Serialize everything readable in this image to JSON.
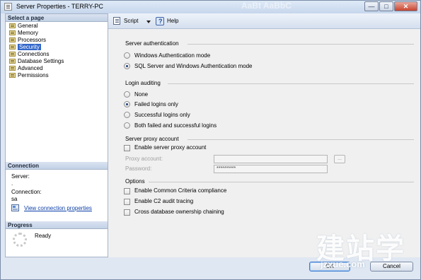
{
  "window": {
    "title": "Server Properties - TERRY-PC",
    "ghost_text": "AaBt AaBbC"
  },
  "titlebar_buttons": {
    "minimize": "—",
    "maximize": "□",
    "close": "✕"
  },
  "left": {
    "select_page_header": "Select a page",
    "pages": [
      {
        "label": "General"
      },
      {
        "label": "Memory"
      },
      {
        "label": "Processors"
      },
      {
        "label": "Security",
        "selected": true
      },
      {
        "label": "Connections"
      },
      {
        "label": "Database Settings"
      },
      {
        "label": "Advanced"
      },
      {
        "label": "Permissions"
      }
    ],
    "connection_header": "Connection",
    "server_label": "Server:",
    "server_value": ".",
    "connection_label": "Connection:",
    "connection_value": "sa",
    "view_link": "View connection properties",
    "progress_header": "Progress",
    "progress_status": "Ready"
  },
  "toolbar": {
    "script_label": "Script",
    "help_label": "Help"
  },
  "server_auth": {
    "title": "Server authentication",
    "options": [
      {
        "label": "Windows Authentication mode",
        "checked": false
      },
      {
        "label": "SQL Server and Windows Authentication mode",
        "checked": true
      }
    ]
  },
  "login_auditing": {
    "title": "Login auditing",
    "options": [
      {
        "label": "None",
        "checked": false
      },
      {
        "label": "Failed logins only",
        "checked": true
      },
      {
        "label": "Successful logins only",
        "checked": false
      },
      {
        "label": "Both failed and successful logins",
        "checked": false
      }
    ]
  },
  "proxy": {
    "title": "Server proxy account",
    "enable_label": "Enable server proxy account",
    "proxy_account_label": "Proxy account:",
    "proxy_account_value": "",
    "password_label": "Password:",
    "password_value": "**********",
    "browse_label": "..."
  },
  "options": {
    "title": "Options",
    "items": [
      {
        "label": "Enable Common Criteria compliance",
        "checked": false
      },
      {
        "label": "Enable C2 audit tracing",
        "checked": false
      },
      {
        "label": "Cross database ownership chaining",
        "checked": false
      }
    ]
  },
  "buttons": {
    "ok": "OK",
    "cancel": "Cancel"
  },
  "watermark": {
    "text": "建站学",
    "url": "jzxue.com"
  }
}
